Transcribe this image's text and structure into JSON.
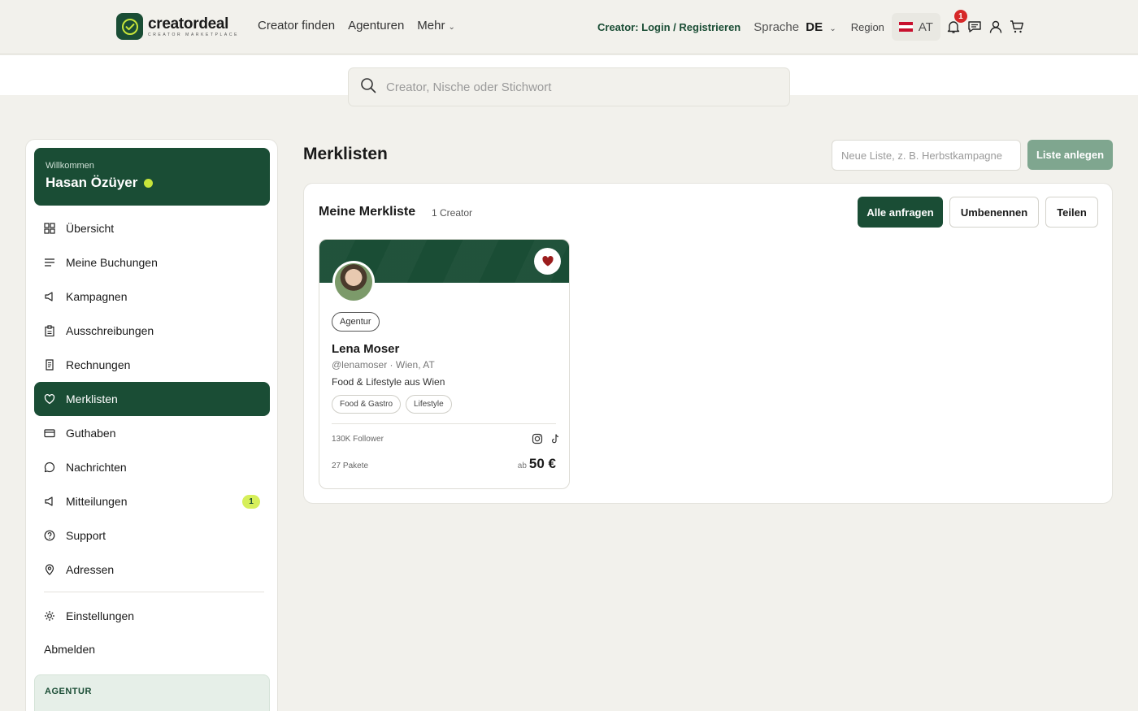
{
  "brand": {
    "name": "creatordeal",
    "sub": "CREATOR MARKETPLACE"
  },
  "nav": {
    "find_creator": "Creator finden",
    "agencies": "Agenturen",
    "more": "Mehr"
  },
  "header": {
    "creator_login": "Creator: Login / Registrieren",
    "language_label": "Sprache",
    "language_value": "DE",
    "region_label": "Region",
    "region_value": "AT",
    "notification_count": "1"
  },
  "search": {
    "placeholder": "Creator, Nische oder Stichwort"
  },
  "sidebar": {
    "welcome": "Willkommen",
    "user_name": "Hasan Özüyer",
    "items": [
      {
        "label": "Übersicht",
        "icon": "grid-icon"
      },
      {
        "label": "Meine Buchungen",
        "icon": "list-icon"
      },
      {
        "label": "Kampagnen",
        "icon": "megaphone-icon"
      },
      {
        "label": "Ausschreibungen",
        "icon": "clipboard-icon"
      },
      {
        "label": "Rechnungen",
        "icon": "receipt-icon"
      },
      {
        "label": "Merklisten",
        "icon": "heart-icon",
        "active": true
      },
      {
        "label": "Guthaben",
        "icon": "credit-card-icon"
      },
      {
        "label": "Nachrichten",
        "icon": "chat-icon"
      },
      {
        "label": "Mitteilungen",
        "icon": "megaphone-icon",
        "count": "1"
      },
      {
        "label": "Support",
        "icon": "help-icon"
      },
      {
        "label": "Adressen",
        "icon": "pin-icon"
      }
    ],
    "settings": "Einstellungen",
    "logout": "Abmelden",
    "agency_section": "AGENTUR"
  },
  "main": {
    "title": "Merklisten",
    "new_list_placeholder": "Neue Liste, z. B. Herbstkampagne",
    "create_button": "Liste anlegen",
    "list": {
      "title": "Meine Merkliste",
      "count": "1 Creator",
      "request_all": "Alle anfragen",
      "rename": "Umbenennen",
      "share": "Teilen"
    },
    "card": {
      "tag": "Agentur",
      "name": "Lena Moser",
      "meta": "@lenamoser · Wien, AT",
      "description": "Food & Lifestyle aus Wien",
      "chips": [
        "Food & Gastro",
        "Lifestyle"
      ],
      "followers": "130K Follower",
      "packages": "27 Pakete",
      "price_prefix": "ab",
      "price": "50 €"
    }
  },
  "colors": {
    "brand": "#1a4d35",
    "accent": "#d6ef5a",
    "background": "#f2f1ec",
    "heart": "#9b1c1c"
  }
}
